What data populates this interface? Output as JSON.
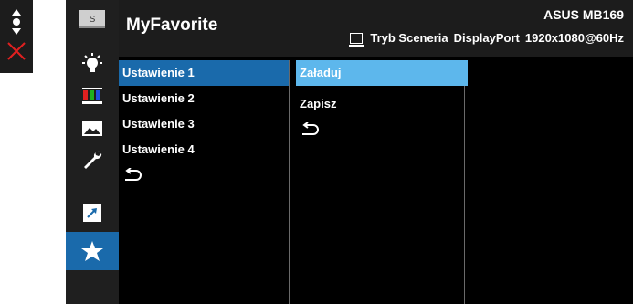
{
  "header": {
    "title": "MyFavorite",
    "model": "ASUS MB169",
    "mode": "Tryb Sceneria",
    "input": "DisplayPort",
    "resolution": "1920x1080@60Hz"
  },
  "key_guide": [
    "nav-up-down-icon",
    "close-icon"
  ],
  "sidebar": {
    "items": [
      {
        "icon": "splendid-logo-icon",
        "active": false
      },
      {
        "icon": "blue-light-filter-icon",
        "active": false
      },
      {
        "icon": "color-bars-icon",
        "active": false
      },
      {
        "icon": "image-icon",
        "active": false
      },
      {
        "icon": "wrench-icon",
        "active": false
      },
      {
        "icon": "shortcut-icon",
        "active": false
      },
      {
        "icon": "star-icon",
        "active": true
      }
    ]
  },
  "settings_menu": {
    "items": [
      "Ustawienie 1",
      "Ustawienie 2",
      "Ustawienie 3",
      "Ustawienie 4"
    ],
    "selected": "Ustawienie 1",
    "back_icon": "back-arrow-icon"
  },
  "action_menu": {
    "items": [
      "Załaduj",
      "Zapisz"
    ],
    "highlighted": "Załaduj",
    "back_icon": "back-arrow-icon"
  },
  "colors": {
    "osd_bg": "#000000",
    "rail_bg": "#1f1f1f",
    "accent": "#1a6aab",
    "highlight": "#5db7ec"
  }
}
